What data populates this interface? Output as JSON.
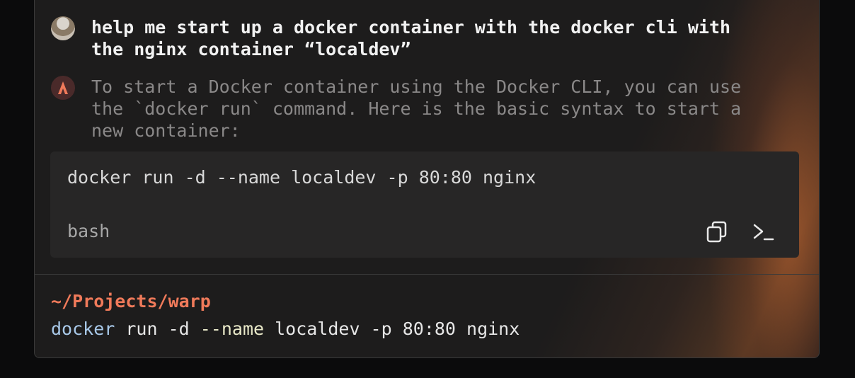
{
  "conversation": {
    "user_message": "help me start up a docker container with the docker cli with\nthe nginx container “localdev”",
    "ai_message": "To start a Docker container using the Docker CLI, you can use\nthe `docker run` command. Here is the basic syntax to start a\nnew container:"
  },
  "code_block": {
    "code": "docker run -d --name localdev -p 80:80 nginx",
    "language": "bash",
    "copy_icon": "copy-icon",
    "run_icon": "terminal-prompt-icon"
  },
  "terminal": {
    "cwd": "~/Projects/warp",
    "command_parts": {
      "cmd": "docker",
      "args1": " run -d ",
      "flag": "--name",
      "args2": " localdev -p 80:80 nginx"
    }
  },
  "colors": {
    "accent": "#f07a5a",
    "background": "#1d1c1c",
    "code_background": "#272626"
  }
}
